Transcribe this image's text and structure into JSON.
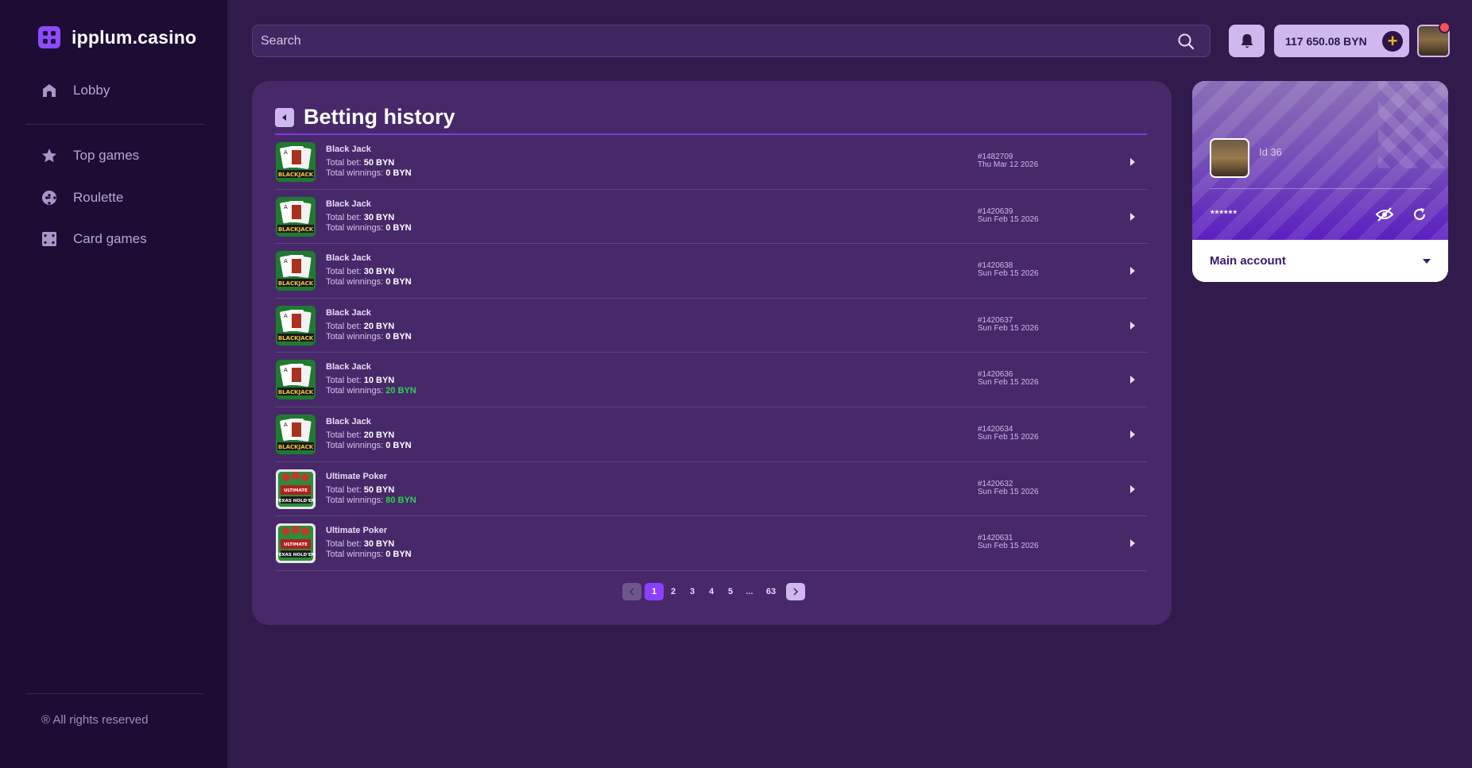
{
  "brand": {
    "name": "ipplum.casino"
  },
  "sidebar": {
    "items": [
      {
        "label": "Lobby",
        "icon": "home-icon"
      },
      {
        "label": "Top games",
        "icon": "star-icon"
      },
      {
        "label": "Roulette",
        "icon": "roulette-icon"
      },
      {
        "label": "Card games",
        "icon": "dice-icon"
      }
    ],
    "footer": "® All rights reserved"
  },
  "header": {
    "search_placeholder": "Search",
    "balance": "117 650.08 BYN"
  },
  "history": {
    "title": "Betting history",
    "bet_label": "Total bet:",
    "win_label": "Total winnings:",
    "rows": [
      {
        "game": "Black Jack",
        "thumb": "blackjack",
        "bet": "50 BYN",
        "win": "0 BYN",
        "win_positive": false,
        "id": "#1482709",
        "date": "Thu Mar 12 2026"
      },
      {
        "game": "Black Jack",
        "thumb": "blackjack",
        "bet": "30 BYN",
        "win": "0 BYN",
        "win_positive": false,
        "id": "#1420639",
        "date": "Sun Feb 15 2026"
      },
      {
        "game": "Black Jack",
        "thumb": "blackjack",
        "bet": "30 BYN",
        "win": "0 BYN",
        "win_positive": false,
        "id": "#1420638",
        "date": "Sun Feb 15 2026"
      },
      {
        "game": "Black Jack",
        "thumb": "blackjack",
        "bet": "20 BYN",
        "win": "0 BYN",
        "win_positive": false,
        "id": "#1420637",
        "date": "Sun Feb 15 2026"
      },
      {
        "game": "Black Jack",
        "thumb": "blackjack",
        "bet": "10 BYN",
        "win": "20 BYN",
        "win_positive": true,
        "id": "#1420636",
        "date": "Sun Feb 15 2026"
      },
      {
        "game": "Black Jack",
        "thumb": "blackjack",
        "bet": "20 BYN",
        "win": "0 BYN",
        "win_positive": false,
        "id": "#1420634",
        "date": "Sun Feb 15 2026"
      },
      {
        "game": "Ultimate Poker",
        "thumb": "ultimate-poker",
        "bet": "50 BYN",
        "win": "80 BYN",
        "win_positive": true,
        "id": "#1420632",
        "date": "Sun Feb 15 2026"
      },
      {
        "game": "Ultimate Poker",
        "thumb": "ultimate-poker",
        "bet": "30 BYN",
        "win": "0 BYN",
        "win_positive": false,
        "id": "#1420631",
        "date": "Sun Feb 15 2026"
      }
    ]
  },
  "pagination": {
    "pages": [
      "1",
      "2",
      "3",
      "4",
      "5"
    ],
    "ellipsis": "...",
    "last": "63",
    "current": "1"
  },
  "account": {
    "id_label": "Id 36",
    "hidden_balance": "******",
    "selected": "Main account"
  },
  "colors": {
    "accent": "#8c3fff",
    "positive": "#2fd04e",
    "notification": "#ff4d5e",
    "plus": "#f5b318"
  }
}
